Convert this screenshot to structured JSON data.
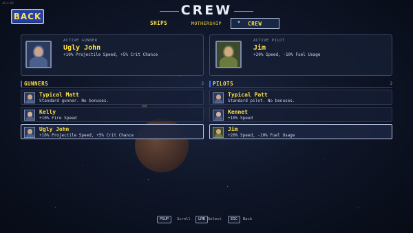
{
  "version_text": "v0.4.02",
  "back_label": "BACK",
  "title": "CREW",
  "tabs": [
    {
      "label": "SHIPS",
      "active": false
    },
    {
      "label": "MOTHERSHIP",
      "active": false
    },
    {
      "label": "CREW",
      "active": true
    }
  ],
  "active_gunner": {
    "kicker": "ACTIVE GUNNER",
    "name": "Ugly John",
    "bonus": "+10% Projectile Speed, +5% Crit Chance",
    "portrait_icon": "gunner-portrait-icon"
  },
  "active_pilot": {
    "kicker": "ACTIVE PILOT",
    "name": "Jim",
    "bonus": "+20% Speed, -10% Fuel Usage",
    "portrait_icon": "pilot-portrait-icon"
  },
  "gunners": {
    "heading": "GUNNERS",
    "count": "3",
    "items": [
      {
        "name": "Typical Matt",
        "bonus": "Standard gunner. No bonuses.",
        "selected": false
      },
      {
        "name": "Kelly",
        "bonus": "+10% Fire Speed",
        "selected": false
      },
      {
        "name": "Ugly John",
        "bonus": "+10% Projectile Speed, +5% Crit Chance",
        "selected": true
      }
    ]
  },
  "pilots": {
    "heading": "PILOTS",
    "count": "3",
    "items": [
      {
        "name": "Typical Patt",
        "bonus": "Standard pilot. No bonuses.",
        "selected": false
      },
      {
        "name": "Kennet",
        "bonus": "+10% Speed",
        "selected": false
      },
      {
        "name": "Jim",
        "bonus": "+20% Speed, -10% Fuel Usage",
        "selected": true
      }
    ]
  },
  "hints": [
    {
      "key": "PGUP",
      "label": "Scroll"
    },
    {
      "key": "LMB",
      "label": "Select"
    },
    {
      "key": "ESC",
      "label": "Back"
    }
  ],
  "colors": {
    "accent_yellow": "#ffe14a",
    "back_button_blue": "#1f3fb0",
    "section_bar_blue": "#3b6bff"
  }
}
